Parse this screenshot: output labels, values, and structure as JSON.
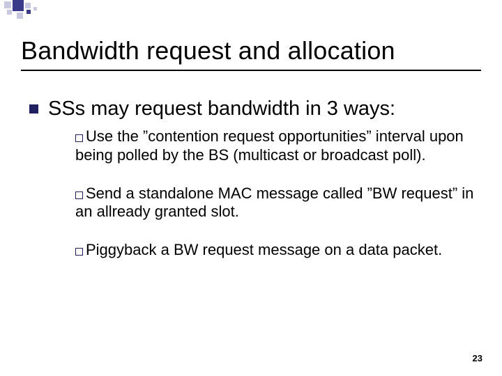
{
  "title": "Bandwidth request and allocation",
  "main_point": "SSs may request bandwidth in 3 ways:",
  "sub": [
    {
      "lead": "Use",
      "rest": " the ”contention request opportunities” interval upon being polled by the BS (multicast or broadcast poll)."
    },
    {
      "lead": "Send",
      "rest": " a standalone MAC message called ”BW request” in an allready granted slot."
    },
    {
      "lead": "Piggyback",
      "rest": " a BW request message on a data packet."
    }
  ],
  "page_number": "23"
}
